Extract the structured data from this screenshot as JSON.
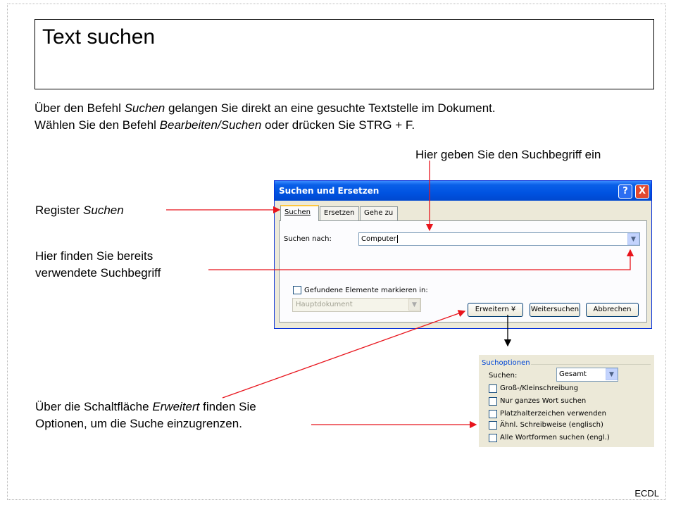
{
  "slide": {
    "title": "Text suchen",
    "intro_line1_a": "Über den Befehl ",
    "intro_line1_b": "Suchen",
    "intro_line1_c": " gelangen Sie direkt an eine gesuchte Textstelle im Dokument.",
    "intro_line2_a": "Wählen Sie den Befehl ",
    "intro_line2_b": "Bearbeiten/Suchen",
    "intro_line2_c": " oder drücken Sie STRG + F.",
    "footer": "ECDL"
  },
  "callouts": {
    "search_term": "Hier geben Sie den Suchbegriff ein",
    "register_a": "Register ",
    "register_b": "Suchen",
    "history_line1": "Hier finden Sie bereits",
    "history_line2": "verwendete Suchbegriff",
    "options_line1_a": "Über die Schaltfläche ",
    "options_line1_b": "Erweitert",
    "options_line1_c": " finden Sie",
    "options_line2": "Optionen, um die Suche einzugrenzen."
  },
  "dialog": {
    "title": "Suchen und Ersetzen",
    "help_label": "?",
    "close_label": "X",
    "tabs": [
      "Suchen",
      "Ersetzen",
      "Gehe zu"
    ],
    "search_label": "Suchen nach:",
    "search_value": "Computer",
    "highlight_label": "Gefundene Elemente markieren in:",
    "highlight_value": "Hauptdokument",
    "buttons": {
      "more": "Erweitern ¥",
      "find_next": "Weitersuchen",
      "cancel": "Abbrechen"
    }
  },
  "options": {
    "header": "Suchoptionen",
    "search_label": "Suchen:",
    "search_value": "Gesamt",
    "checkboxes": [
      "Groß-/Kleinschreibung",
      "Nur ganzes Wort suchen",
      "Platzhalterzeichen verwenden",
      "Ähnl. Schreibweise (englisch)",
      "Alle Wortformen suchen (engl.)"
    ]
  },
  "colors": {
    "arrow": "#e8141c",
    "titlebar": "#0053e1",
    "dialog_bg": "#ece9d8"
  }
}
